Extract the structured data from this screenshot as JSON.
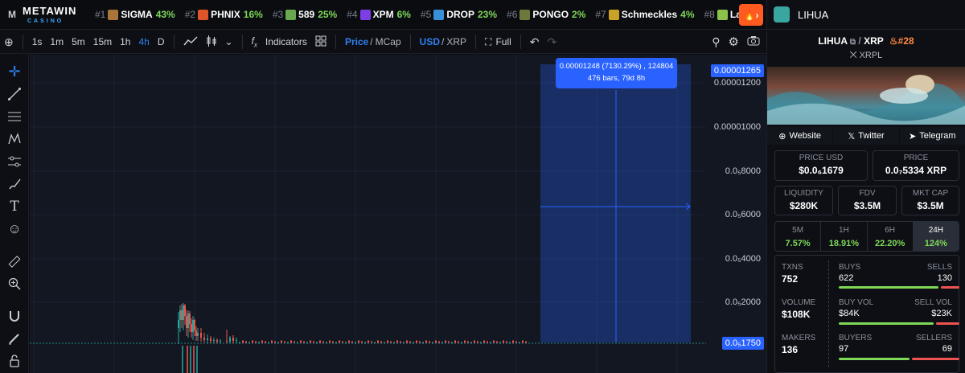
{
  "ticker": {
    "logo_line1": "METAWIN",
    "logo_line2": "CASINO",
    "items": [
      {
        "rank": "#1",
        "symbol": "SIGMA",
        "change": "43%",
        "icon": "sigma-icon",
        "color": "#a8743a"
      },
      {
        "rank": "#2",
        "symbol": "PHNIX",
        "change": "16%",
        "icon": "phoenix-icon",
        "color": "#e0542a"
      },
      {
        "rank": "#3",
        "symbol": "589",
        "change": "25%",
        "icon": "589-icon",
        "color": "#6aa84f"
      },
      {
        "rank": "#4",
        "symbol": "XPM",
        "change": "6%",
        "icon": "xpm-icon",
        "color": "#7b3fe4"
      },
      {
        "rank": "#5",
        "symbol": "DROP",
        "change": "23%",
        "icon": "drop-icon",
        "color": "#3a8fd9"
      },
      {
        "rank": "#6",
        "symbol": "PONGO",
        "change": "2%",
        "icon": "pongo-icon",
        "color": "#6b7a3a"
      },
      {
        "rank": "#7",
        "symbol": "Schmeckles",
        "change": "4%",
        "icon": "schmeckles-icon",
        "color": "#c9a227"
      },
      {
        "rank": "#8",
        "symbol": "Laug",
        "change": "",
        "icon": "laugh-icon",
        "color": "#8bc34a"
      }
    ]
  },
  "toolbar": {
    "intervals": [
      "1s",
      "1m",
      "5m",
      "15m",
      "1h",
      "4h",
      "D"
    ],
    "active_interval": "4h",
    "indicators_label": "Indicators",
    "price_label": "Price",
    "mcap_label": "MCap",
    "usd_label": "USD",
    "xrp_label": "XRP",
    "full_label": "Full",
    "slash": "/"
  },
  "chart": {
    "price_labels": [
      "0.00001200",
      "0.00001000",
      "0.0₅8000",
      "0.0₅6000",
      "0.0₅4000",
      "0.0₅2000"
    ],
    "top_badge": "0.00001265",
    "bottom_badge": "0.0₅1750",
    "measure_line1": "0.00001248 (7130.29%) , 124804",
    "measure_line2": "476 bars, 79d 8h",
    "up_color": "#26a69a",
    "down_color": "#ef5350"
  },
  "panel": {
    "token_name": "LIHUA",
    "pair_base": "LIHUA",
    "pair_quote": "XRP",
    "rank": "#28",
    "chain": "XRPL",
    "links": {
      "website": "Website",
      "twitter": "Twitter",
      "telegram": "Telegram"
    },
    "price_usd_label": "PRICE USD",
    "price_usd": "$0.0₆1679",
    "price_label": "PRICE",
    "price_xrp": "0.0₇5334 XRP",
    "liquidity_label": "LIQUIDITY",
    "liquidity": "$280K",
    "fdv_label": "FDV",
    "fdv": "$3.5M",
    "mcap_label": "MKT CAP",
    "mcap": "$3.5M",
    "timeframes": [
      {
        "label": "5M",
        "value": "7.57%"
      },
      {
        "label": "1H",
        "value": "18.91%"
      },
      {
        "label": "6H",
        "value": "22.20%"
      },
      {
        "label": "24H",
        "value": "124%"
      }
    ],
    "stats": {
      "txns_label": "TXNS",
      "txns": "752",
      "buys_label": "BUYS",
      "buys": "622",
      "sells_label": "SELLS",
      "sells": "130",
      "volume_label": "VOLUME",
      "volume": "$108K",
      "buyvol_label": "BUY VOL",
      "buyvol": "$84K",
      "sellvol_label": "SELL VOL",
      "sellvol": "$23K",
      "makers_label": "MAKERS",
      "makers": "136",
      "buyers_label": "BUYERS",
      "buyers": "97",
      "sellers_label": "SELLERS",
      "sellers": "69"
    },
    "buy_color": "#7ed957",
    "sell_color": "#ef5350"
  }
}
